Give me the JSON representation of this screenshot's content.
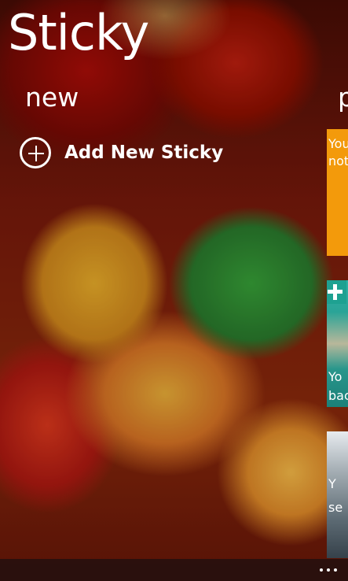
{
  "app": {
    "title": "Sticky"
  },
  "sections": {
    "current": "new",
    "next_partial": "p"
  },
  "actions": {
    "add_new_sticky": "Add New Sticky",
    "add_icon": "plus-circle-icon",
    "more_icon": "ellipsis-icon"
  },
  "tiles": [
    {
      "line1": "You",
      "line2": "not",
      "color": "#f39a0b"
    },
    {
      "line1": "Yo",
      "line2": "bac",
      "color": "#2aa497",
      "badge_icon": "plus-badge-icon"
    },
    {
      "line1": "Y",
      "line2": "se",
      "color": "#5c6a73"
    }
  ]
}
